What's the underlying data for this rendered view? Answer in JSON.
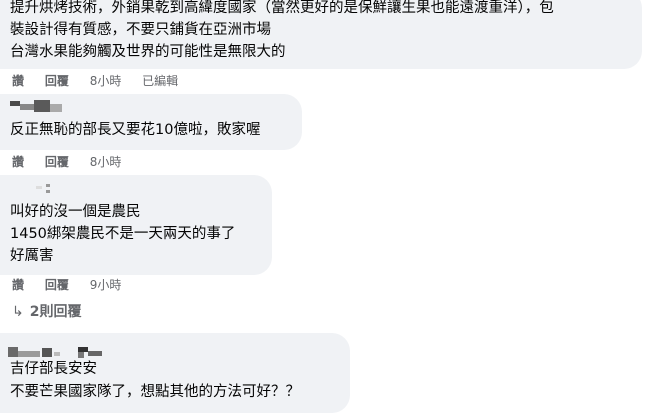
{
  "comments": [
    {
      "lines": [
        "提升烘烤技術，外銷果乾到高緯度國家（當然更好的是保鮮讓生果也能遠渡重洋），包",
        "裝設計得有質感，不要只鋪貨在亞洲市場",
        "台灣水果能夠觸及世界的可能性是無限大的"
      ],
      "actions": {
        "like": "讚",
        "reply": "回覆",
        "time": "8小時",
        "edited": "已編輯"
      }
    },
    {
      "lines": [
        "反正無恥的部長又要花10億啦，敗家喔"
      ],
      "actions": {
        "like": "讚",
        "reply": "回覆",
        "time": "8小時"
      }
    },
    {
      "lines": [
        "叫好的沒一個是農民",
        "1450綁架農民不是一天兩天的事了",
        "好厲害"
      ],
      "actions": {
        "like": "讚",
        "reply": "回覆",
        "time": "9小時"
      }
    },
    {
      "lines": [
        "吉仔部長安安",
        "不要芒果國家隊了，想點其他的方法可好？？"
      ]
    }
  ],
  "view_replies": {
    "arrow": "↳",
    "label": "2則回覆"
  }
}
